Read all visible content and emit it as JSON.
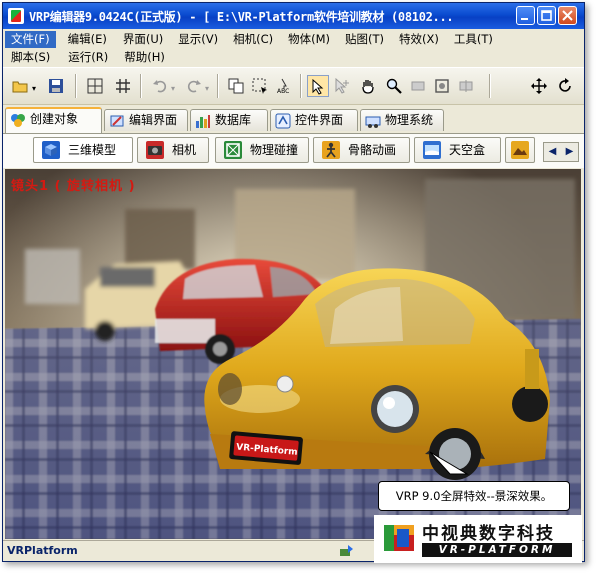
{
  "window": {
    "title": "VRP编辑器9.0424C(正式版) - [ E:\\VR-Platform软件培训教材 (08102...",
    "controls": {
      "minimize": "minimize-icon",
      "maximize": "maximize-icon",
      "close": "close-icon"
    }
  },
  "menu": {
    "row1": [
      "文件(F)",
      "编辑(E)",
      "界面(U)",
      "显示(V)",
      "相机(C)",
      "物体(M)",
      "贴图(T)",
      "特效(X)",
      "工具(T)"
    ],
    "row2": [
      "脚本(S)",
      "运行(R)",
      "帮助(H)"
    ],
    "active": "文件(F)"
  },
  "toolbar": {
    "icons": [
      "open-folder-icon",
      "save-icon",
      "grid-icon",
      "snap-grid-icon",
      "undo-icon",
      "redo-icon",
      "copy-icon",
      "marquee-select-icon",
      "rename-abc-icon",
      "pointer-select-icon",
      "pointer-add-icon",
      "hand-pan-icon",
      "zoom-icon",
      "link-icon",
      "frame-icon",
      "unlink-icon",
      "move-icon",
      "rotate-icon"
    ]
  },
  "tabs_main": [
    {
      "label": "创建对象",
      "icon": "create-object-icon",
      "active": true
    },
    {
      "label": "编辑界面",
      "icon": "edit-ui-icon",
      "active": false
    },
    {
      "label": "数据库",
      "icon": "database-icon",
      "active": false
    },
    {
      "label": "控件界面",
      "icon": "controls-icon",
      "active": false
    },
    {
      "label": "物理系统",
      "icon": "physics-icon",
      "active": false
    }
  ],
  "tabs_sub": [
    {
      "label": "三维模型",
      "icon": "3d-model-icon",
      "active": true
    },
    {
      "label": "相机",
      "icon": "camera-icon",
      "active": false
    },
    {
      "label": "物理碰撞",
      "icon": "collision-icon",
      "active": false
    },
    {
      "label": "骨骼动画",
      "icon": "skeleton-icon",
      "active": false
    },
    {
      "label": "天空盒",
      "icon": "skybox-icon",
      "active": false
    },
    {
      "label": "",
      "icon": "landscape-icon",
      "active": false
    }
  ],
  "viewport": {
    "camera_label": "镜头1 ( 旋转相机 )",
    "callout": "VRP 9.0全屏特效--景深效果。",
    "plate_text": "VR-Platform"
  },
  "status": {
    "text": "VRPlatform"
  },
  "branding": {
    "cn": "中视典数字科技",
    "en": "VR-PLATFORM"
  },
  "colors": {
    "titlebar": "#0a4bd0",
    "accent_red": "#d41a12",
    "car_yellow": "#e8b320",
    "car_red": "#c81a1a"
  }
}
